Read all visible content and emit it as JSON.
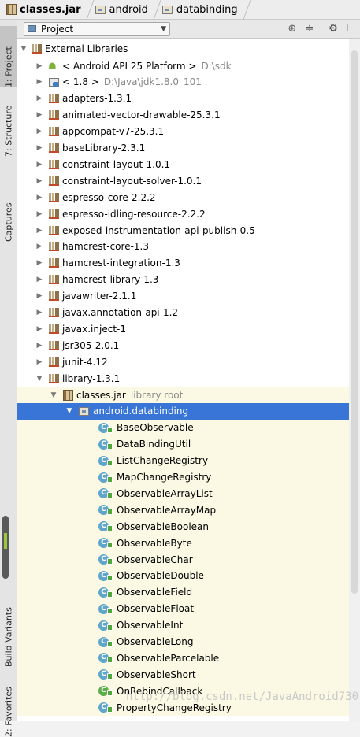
{
  "breadcrumb": [
    {
      "label": "classes.jar",
      "icon": "jar-icon"
    },
    {
      "label": "android",
      "icon": "package-icon"
    },
    {
      "label": "databinding",
      "icon": "package-icon"
    }
  ],
  "left_strip": {
    "project": "1: Project",
    "structure": "7: Structure",
    "captures": "Captures",
    "build_variants": "Build Variants",
    "favorites": "2: Favorites"
  },
  "panel": {
    "view_mode": "Project",
    "tools": [
      "sync-icon",
      "collapse-icon",
      "gear-icon",
      "pin-icon"
    ]
  },
  "tree": {
    "root": "External Libraries",
    "libs": [
      {
        "name": "< Android API 25 Platform >",
        "secondary": "D:\\sdk",
        "icon": "android-icon"
      },
      {
        "name": "< 1.8 >",
        "secondary": "D:\\Java\\jdk1.8.0_101",
        "icon": "jdk-icon"
      },
      {
        "name": "adapters-1.3.1"
      },
      {
        "name": "animated-vector-drawable-25.3.1"
      },
      {
        "name": "appcompat-v7-25.3.1"
      },
      {
        "name": "baseLibrary-2.3.1"
      },
      {
        "name": "constraint-layout-1.0.1"
      },
      {
        "name": "constraint-layout-solver-1.0.1"
      },
      {
        "name": "espresso-core-2.2.2"
      },
      {
        "name": "espresso-idling-resource-2.2.2"
      },
      {
        "name": "exposed-instrumentation-api-publish-0.5"
      },
      {
        "name": "hamcrest-core-1.3"
      },
      {
        "name": "hamcrest-integration-1.3"
      },
      {
        "name": "hamcrest-library-1.3"
      },
      {
        "name": "javawriter-2.1.1"
      },
      {
        "name": "javax.annotation-api-1.2"
      },
      {
        "name": "javax.inject-1"
      },
      {
        "name": "jsr305-2.0.1"
      },
      {
        "name": "junit-4.12"
      },
      {
        "name": "library-1.3.1"
      }
    ],
    "jar": {
      "name": "classes.jar",
      "secondary": "library root"
    },
    "package": "android.databinding",
    "classes": [
      "BaseObservable",
      "DataBindingUtil",
      "ListChangeRegistry",
      "MapChangeRegistry",
      "ObservableArrayList",
      "ObservableArrayMap",
      "ObservableBoolean",
      "ObservableByte",
      "ObservableChar",
      "ObservableDouble",
      "ObservableField",
      "ObservableFloat",
      "ObservableInt",
      "ObservableLong",
      "ObservableParcelable",
      "ObservableShort",
      "OnRebindCallback",
      "PropertyChangeRegistry"
    ]
  },
  "watermark": "http://blog.csdn.net/JavaAndroid730"
}
